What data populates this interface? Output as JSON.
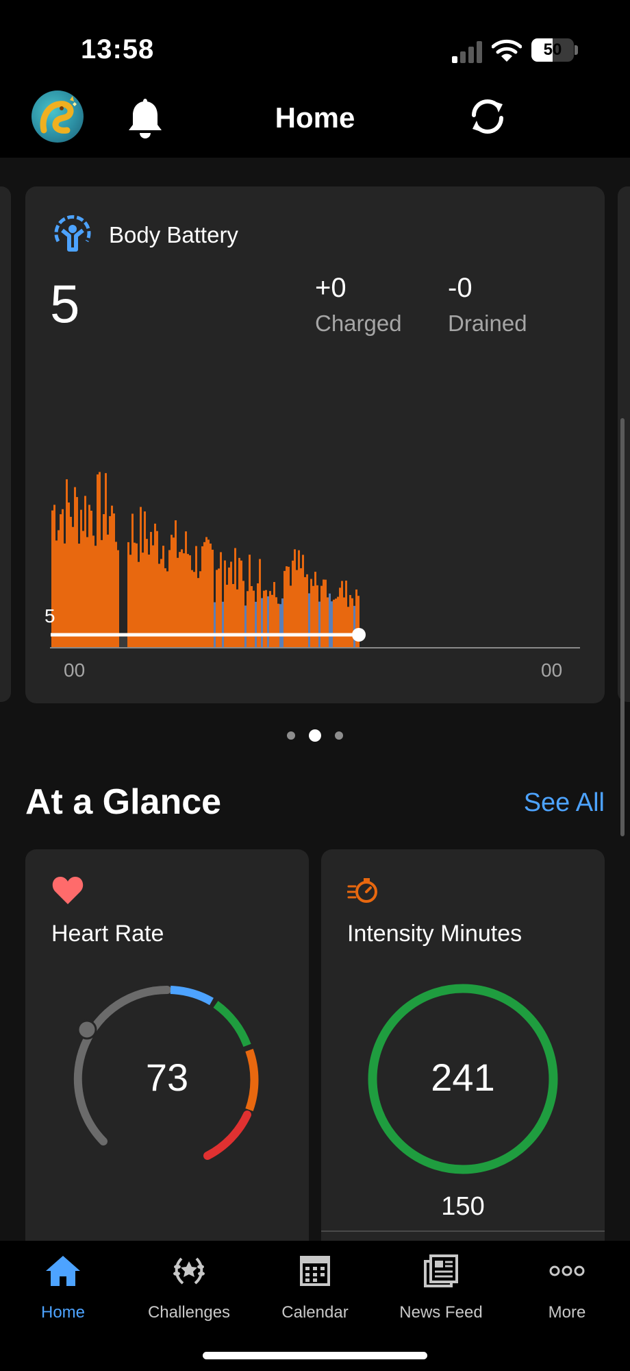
{
  "status_bar": {
    "time": "13:58",
    "battery_percent": "50"
  },
  "nav": {
    "title": "Home",
    "avatar_icon": "dragon-avatar-icon",
    "bell_icon": "bell-icon",
    "sync_icon": "sync-icon"
  },
  "body_battery": {
    "title": "Body Battery",
    "value": "5",
    "charged_value": "+0",
    "charged_label": "Charged",
    "drained_value": "-0",
    "drained_label": "Drained",
    "current_marker_label": "5",
    "x_tick_start": "00",
    "x_tick_end": "00",
    "bar_color": "#e8680f",
    "rest_color": "#5b7fb8",
    "gap_color": "#3a3a3a"
  },
  "carousel": {
    "page_count": 3,
    "active_index": 1
  },
  "at_a_glance": {
    "title": "At a Glance",
    "see_all": "See All",
    "heart_rate": {
      "label": "Heart Rate",
      "value": "73",
      "icon": "heart-icon",
      "color": "#ff6b6b"
    },
    "intensity_minutes": {
      "label": "Intensity Minutes",
      "value": "241",
      "goal": "150",
      "icon": "stopwatch-icon",
      "color": "#1f9d3f"
    }
  },
  "tab_bar": {
    "tabs": [
      {
        "label": "Home",
        "icon": "home-icon",
        "active": true
      },
      {
        "label": "Challenges",
        "icon": "laurel-icon",
        "active": false
      },
      {
        "label": "Calendar",
        "icon": "calendar-icon",
        "active": false
      },
      {
        "label": "News Feed",
        "icon": "news-feed-icon",
        "active": false
      },
      {
        "label": "More",
        "icon": "more-icon",
        "active": false
      }
    ]
  },
  "colors": {
    "accent": "#4da3ff",
    "card": "#252525",
    "background": "#121212"
  }
}
